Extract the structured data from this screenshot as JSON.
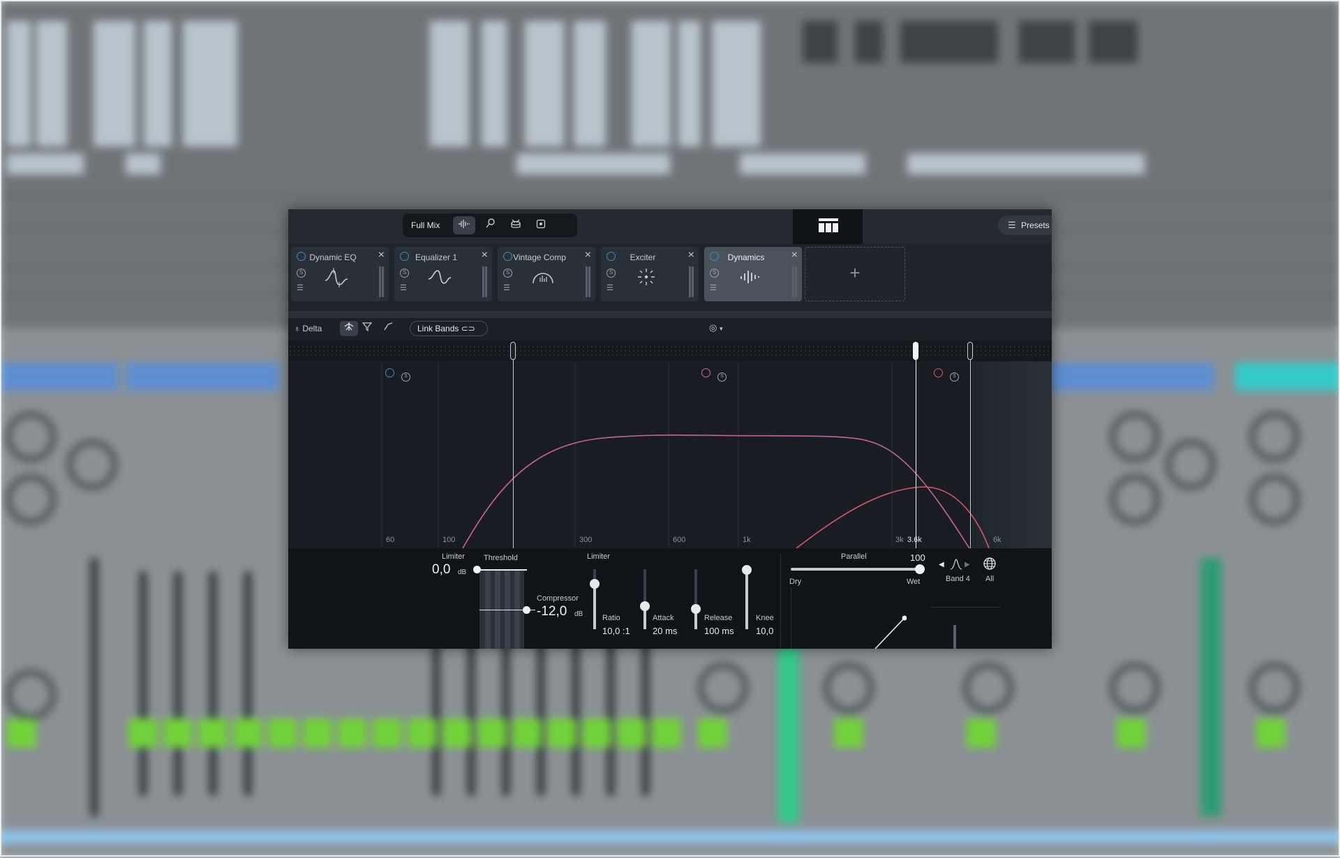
{
  "toolbar": {
    "mode_label": "Full Mix",
    "presets_label": "Presets"
  },
  "modules": [
    {
      "name": "Dynamic EQ",
      "active": false
    },
    {
      "name": "Equalizer 1",
      "active": false
    },
    {
      "name": "Vintage Comp",
      "active": false
    },
    {
      "name": "Exciter",
      "active": false
    },
    {
      "name": "Dynamics",
      "active": true
    }
  ],
  "add_module_label": "+",
  "tools": {
    "delta_label": "Delta",
    "link_bands_label": "Link Bands"
  },
  "eq": {
    "freq_labels": [
      "60",
      "100",
      "300",
      "600",
      "1k",
      "3k",
      "3.6k",
      "6k"
    ],
    "band_colors": {
      "band1": "#3c8fc4",
      "band2": "#d46aa8",
      "band3": "#e0506a"
    },
    "curve_colors": {
      "pink": "#c7649b",
      "red": "#d8566c"
    }
  },
  "dynamics": {
    "limiter_label": "Limiter",
    "limiter_value": "0,0",
    "limiter_unit": "dB",
    "threshold_label": "Threshold",
    "compressor_label": "Compressor",
    "compressor_value": "-12,0",
    "compressor_unit": "dB",
    "limiter2_label": "Limiter",
    "ratio_label": "Ratio",
    "ratio_value": "10,0 :1",
    "attack_label": "Attack",
    "attack_value": "20 ms",
    "release_label": "Release",
    "release_value": "100 ms",
    "knee_label": "Knee",
    "knee_value": "10,0"
  },
  "parallel": {
    "label": "Parallel",
    "value": "100",
    "fraction": 1.0,
    "dry_label": "Dry",
    "wet_label": "Wet"
  },
  "band_select": {
    "band_label": "Band 4",
    "all_label": "All"
  }
}
